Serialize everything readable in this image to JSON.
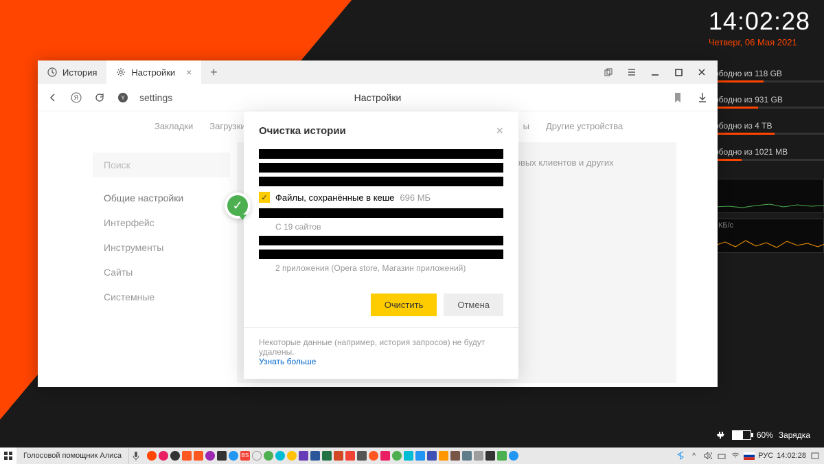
{
  "clock": {
    "time": "14:02:28",
    "date": "Четверг, 06 Мая 2021"
  },
  "disks": [
    {
      "label": "ободно из 118 GB",
      "pct": 45
    },
    {
      "label": "ободно из 931 GB",
      "pct": 40
    },
    {
      "label": "ободно из 4 ТВ",
      "pct": 55
    },
    {
      "label": "ободно из 1021 MB",
      "pct": 25
    }
  ],
  "perf": {
    "net_label": "КБ/с"
  },
  "battery": {
    "pct": "60%",
    "status": "Зарядка",
    "fill": 60
  },
  "browser": {
    "tabs": [
      {
        "label": "История",
        "active": false
      },
      {
        "label": "Настройки",
        "active": true
      }
    ],
    "url": "settings",
    "page_title": "Настройки",
    "sub_nav": [
      "Закладки",
      "Загрузки",
      "ы",
      "Другие устройства"
    ],
    "sidebar": {
      "search_placeholder": "Поиск",
      "items": [
        "Общие настройки",
        "Интерфейс",
        "Инструменты",
        "Сайты",
        "Системные"
      ]
    },
    "panel_text": "товых клиентов и других"
  },
  "dialog": {
    "title": "Очистка истории",
    "cache_label": "Файлы, сохранённые в кеше",
    "cache_size": "696 МБ",
    "sites_text": "С 19 сайтов",
    "apps_text": "2 приложения (Opera store, Магазин приложений)",
    "clear_btn": "Очистить",
    "cancel_btn": "Отмена",
    "footer_text": "Некоторые данные (например, история запросов) не будут удалены.",
    "footer_link": "Узнать больше"
  },
  "taskbar": {
    "assistant": "Голосовой помощник Алиса",
    "lang": "РУС",
    "time": "14:02:28"
  }
}
